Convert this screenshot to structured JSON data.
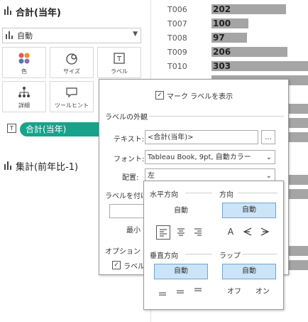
{
  "marks_card": {
    "title": "合計(当年)",
    "mark_type": "自動",
    "buttons": {
      "color": "色",
      "size": "サイズ",
      "label": "ラベル",
      "detail": "詳細",
      "tooltip": "ツールヒント"
    },
    "text_field_icon": "T",
    "pill": "合計(当年)",
    "section2_title": "集計(前年比-1)"
  },
  "chart": {
    "rows": [
      {
        "label": "T006",
        "value": "202"
      },
      {
        "label": "T007",
        "value": "100"
      },
      {
        "label": "T008",
        "value": "97"
      },
      {
        "label": "T009",
        "value": "206"
      },
      {
        "label": "T010",
        "value": "303"
      }
    ],
    "bar_color": "#a5a5a5"
  },
  "label_dialog": {
    "show_labels": "マーク ラベルを表示",
    "appearance_title": "ラベルの外観",
    "text_label": "テキスト:",
    "text_value": "<合計(当年)>",
    "ellipsis": "...",
    "font_label": "フォント:",
    "font_value": "Tableau Book, 9pt, 自動カラー",
    "align_label": "配置:",
    "align_value": "左",
    "label_by_partial": "ラベルを付け",
    "min_partial": "最小",
    "options_title": "オプション",
    "option_partial": "ラベル"
  },
  "alignment_popup": {
    "horizontal_title": "水平方向",
    "horizontal_auto": "自動",
    "direction_title": "方向",
    "direction_auto": "自動",
    "direction_letter": "A",
    "vertical_title": "垂直方向",
    "vertical_auto": "自動",
    "wrap_title": "ラップ",
    "wrap_auto": "自動",
    "wrap_off": "オフ",
    "wrap_on": "オン"
  },
  "colors": {
    "accent_pill": "#17a38a",
    "selected_fill": "#cce4f7",
    "selected_border": "#6aa6d8"
  }
}
